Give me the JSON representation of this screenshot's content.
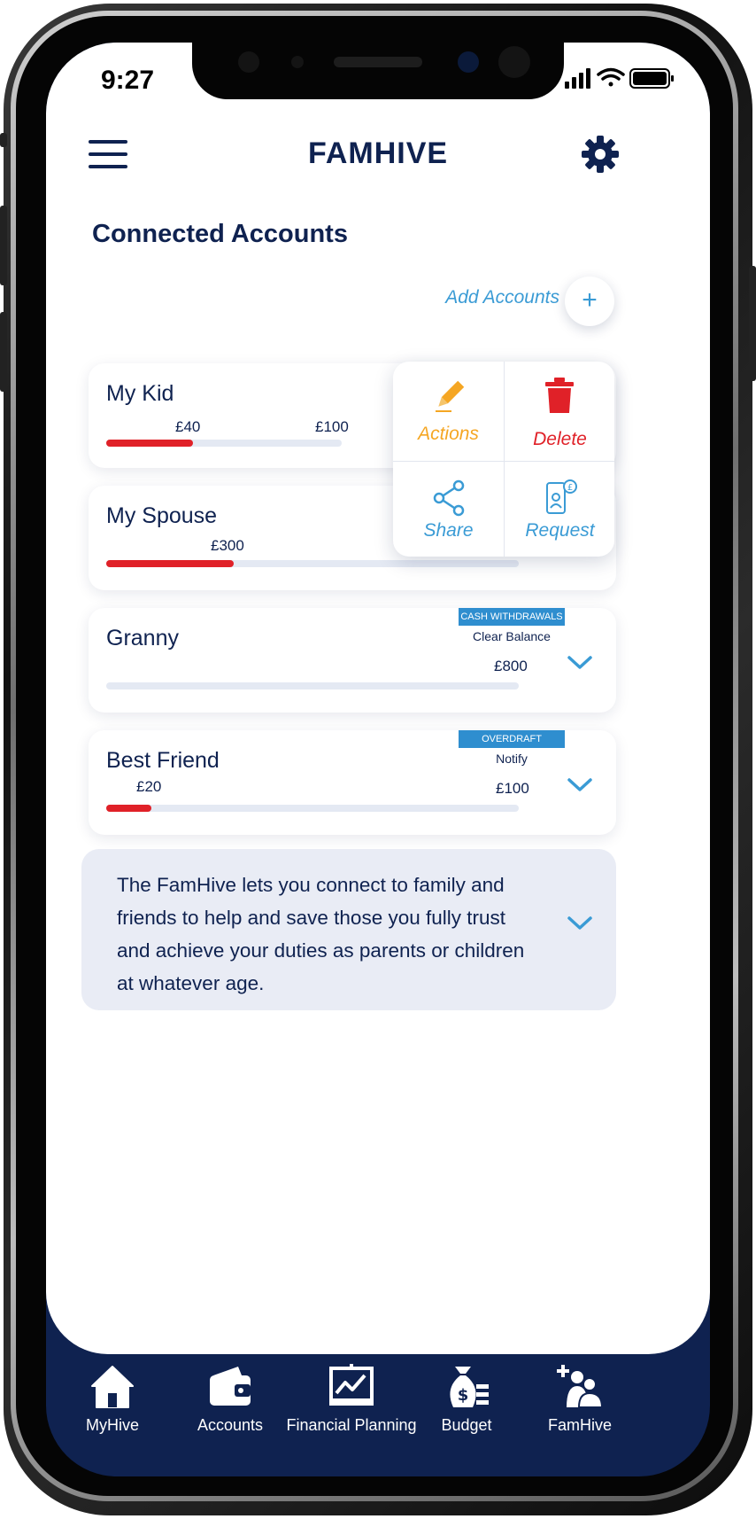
{
  "status_bar": {
    "time": "9:27"
  },
  "header": {
    "title": "FAMHIVE"
  },
  "section_title": "Connected Accounts",
  "add_accounts_label": "Add Accounts",
  "add_button_label": "+",
  "accounts": [
    {
      "name": "My Kid",
      "spent": "£40",
      "limit": "£100",
      "progress": 0.37
    },
    {
      "name": "My Spouse",
      "spent": "£300",
      "progress": 0.31
    },
    {
      "name": "Granny",
      "tag": "CASH WITHDRAWALS",
      "tag_sub": "Clear Balance",
      "limit": "£800",
      "progress": 0
    },
    {
      "name": "Best Friend",
      "tag": "OVERDRAFT",
      "tag_sub": "Notify",
      "spent": "£20",
      "limit": "£100",
      "progress": 0.11
    }
  ],
  "actions_popup": {
    "actions_label": "Actions",
    "delete_label": "Delete",
    "share_label": "Share",
    "request_label": "Request"
  },
  "info_text": "The FamHive lets you connect to family and friends to help and save those you fully trust and achieve your duties as parents or children at whatever age.",
  "bottom_nav": {
    "items": [
      {
        "label": "MyHive",
        "icon": "home-icon"
      },
      {
        "label": "Accounts",
        "icon": "wallet-icon"
      },
      {
        "label": "Financial Planning",
        "icon": "chart-board-icon"
      },
      {
        "label": "Budget",
        "icon": "money-bag-icon"
      },
      {
        "label": "FamHive",
        "icon": "add-family-icon"
      }
    ]
  },
  "colors": {
    "navy": "#0f2250",
    "accent_blue": "#3a9bd5",
    "alert_red": "#e02128",
    "actions_orange": "#f5a623",
    "tag_blue": "#2f8ecf",
    "info_bg": "#e9ecf5"
  }
}
